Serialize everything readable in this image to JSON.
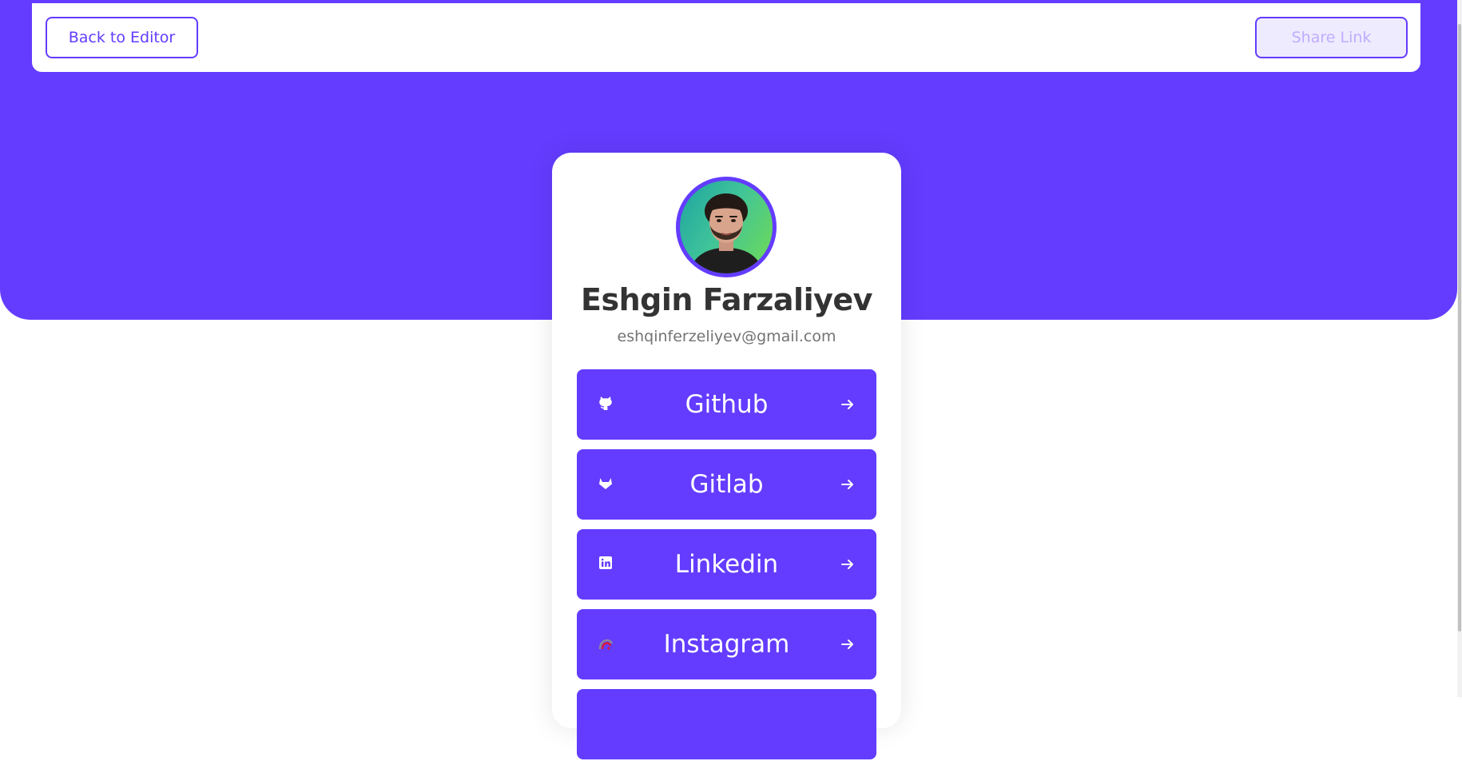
{
  "navbar": {
    "back_label": "Back to Editor",
    "share_label": "Share Link"
  },
  "profile": {
    "name": "Eshgin Farzaliyev",
    "email": "eshqinferzeliyev@gmail.com",
    "avatar": "profile-photo"
  },
  "links": [
    {
      "label": "Github",
      "icon": "github-icon"
    },
    {
      "label": "Gitlab",
      "icon": "gitlab-icon"
    },
    {
      "label": "Linkedin",
      "icon": "linkedin-icon"
    },
    {
      "label": "Instagram",
      "icon": "instagram-icon"
    }
  ],
  "colors": {
    "accent": "#633cff",
    "accent_light": "#efebff",
    "accent_muted": "#beadff",
    "heading": "#333333",
    "body_text": "#737373"
  }
}
